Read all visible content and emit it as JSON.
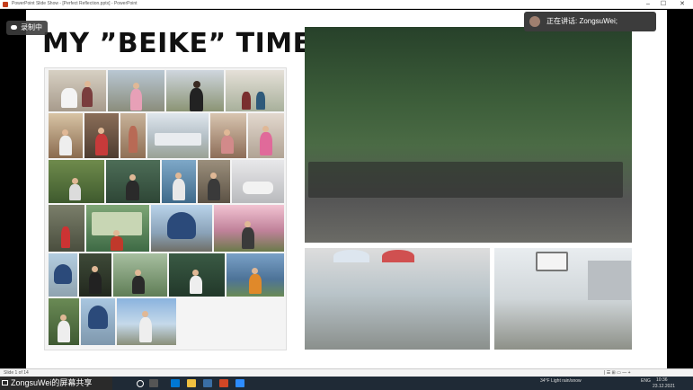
{
  "window": {
    "title": "PowerPoint Slide Show - [Perfect Reflection.pptx] - PowerPoint",
    "minimize": "–",
    "maximize": "☐",
    "close": "✕"
  },
  "slide": {
    "title": "MY ”BEIKE” TIME"
  },
  "recording_badge": {
    "label": "录制中"
  },
  "speaker_banner": {
    "label": "正在讲话: ZongsuWei;"
  },
  "statusbar": {
    "slide_count": "Slide 1 of 14",
    "zoom": "|  ☰  ⊞  ▭  —  +"
  },
  "share_banner": {
    "label": "ZongsuWei的屏幕共享"
  },
  "tray": {
    "weather": "34°F  Light rain/snow",
    "lang": "ENG",
    "time": "10:36",
    "date": "23.12.2021"
  },
  "colors": {
    "slide_bg": "#ffffff",
    "taskbar": "#1f2a36",
    "banner": "#3c3c3c"
  }
}
